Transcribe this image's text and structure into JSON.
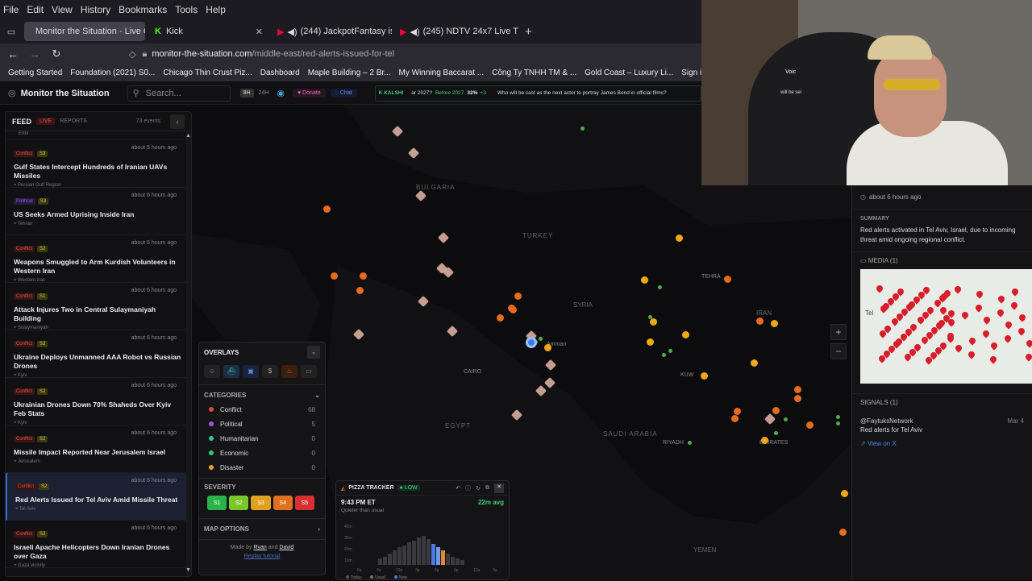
{
  "menubar": [
    "File",
    "Edit",
    "View",
    "History",
    "Bookmarks",
    "Tools",
    "Help"
  ],
  "tabs": [
    {
      "label": "Monitor the Situation - Live Gl",
      "active": true
    },
    {
      "label": "Kick",
      "active": false
    },
    {
      "label": "(244) JackpotFantasy is live!",
      "active": false
    },
    {
      "label": "(245) NDTV 24x7 Live TV: I",
      "active": false
    }
  ],
  "url": {
    "host": "monitor-the-situation.com",
    "path": "/middle-east/red-alerts-issued-for-tel"
  },
  "bookmarks": [
    "Getting Started",
    "Foundation (2021) S0...",
    "Chicago Thin Crust Piz...",
    "Dashboard",
    "Maple Building – 2 Br...",
    "My Winning Baccarat ...",
    "Công Ty TNHH TM & ...",
    "Gold Coast – Luxury Li...",
    "Sign in - Drea"
  ],
  "app": {
    "title": "Monitor the Situation",
    "search_placeholder": "Search...",
    "range_8h": "8H",
    "range_24h": "24H",
    "donate": "Donate",
    "chat": "Chat",
    "kalshi": "KALSHI",
    "ticker_q1": "ar 2027?",
    "ticker_before": "Before 2027",
    "ticker_pct": "32%",
    "ticker_delta": "+3",
    "ticker_q2": "Who will be cast as the next actor to portray James Bond in official films?"
  },
  "feed": {
    "title": "FEED",
    "live": "LIVE",
    "reports": "REPORTS",
    "count": "73 events",
    "top_loc": "Erbil",
    "items": [
      {
        "cat": "Conflict",
        "sev": "S3",
        "time": "about 5 hours ago",
        "title": "Gulf States Intercept Hundreds of Iranian UAVs Missiles",
        "loc": "Persian Gulf Region"
      },
      {
        "cat": "Political",
        "sev": "S3",
        "time": "about 6 hours ago",
        "title": "US Seeks Armed Uprising Inside Iran",
        "loc": "Tehran"
      },
      {
        "cat": "Conflict",
        "sev": "S2",
        "time": "about 6 hours ago",
        "title": "Weapons Smuggled to Arm Kurdish Volunteers in Western Iran",
        "loc": "Western Iran"
      },
      {
        "cat": "Conflict",
        "sev": "S1",
        "time": "about 6 hours ago",
        "title": "Attack Injures Two in Central Sulaymaniyah Building",
        "loc": "Sulaymaniyah"
      },
      {
        "cat": "Conflict",
        "sev": "S2",
        "time": "about 6 hours ago",
        "title": "Ukraine Deploys Unmanned AAA Robot vs Russian Drones",
        "loc": "Kyiv"
      },
      {
        "cat": "Conflict",
        "sev": "S2",
        "time": "about 6 hours ago",
        "title": "Ukrainian Drones Down 70% Shaheds Over Kyiv Feb Stats",
        "loc": "Kyiv"
      },
      {
        "cat": "Conflict",
        "sev": "S2",
        "time": "about 6 hours ago",
        "title": "Missile Impact Reported Near Jerusalem Israel",
        "loc": "Jerusalem"
      },
      {
        "cat": "Conflict",
        "sev": "S2",
        "time": "about 6 hours ago",
        "title": "Red Alerts Issued for Tel Aviv Amid Missile Threat",
        "loc": "Tel Aviv"
      },
      {
        "cat": "Conflict",
        "sev": "S2",
        "time": "about 6 hours ago",
        "title": "Israeli Apache Helicopters Down Iranian Drones over Gaza",
        "loc": "Gaza vicinity"
      }
    ]
  },
  "map_labels": [
    "BULGARIA",
    "TURKEY",
    "SYRIA",
    "TEHRA",
    "IRAN",
    "CAIRO",
    "EGYPT",
    "SAUDI ARABIA",
    "RIYADH",
    "KUW",
    "EMIRATES",
    "Amman",
    "YEMEN"
  ],
  "overlays": {
    "title": "OVERLAYS",
    "categories_title": "CATEGORIES",
    "categories": [
      {
        "name": "Conflict",
        "count": "68",
        "color": "#e0483a"
      },
      {
        "name": "Political",
        "count": "5",
        "color": "#9b59e0"
      },
      {
        "name": "Humanitarian",
        "count": "0",
        "color": "#2ec4a3"
      },
      {
        "name": "Economic",
        "count": "0",
        "color": "#2ecc71"
      },
      {
        "name": "Disaster",
        "count": "0",
        "color": "#f0a020"
      }
    ],
    "severity_title": "SEVERITY",
    "severity": [
      {
        "label": "S1",
        "color": "#2ab34a"
      },
      {
        "label": "S2",
        "color": "#7bc62c"
      },
      {
        "label": "S3",
        "color": "#e0a020"
      },
      {
        "label": "S4",
        "color": "#e07020"
      },
      {
        "label": "S5",
        "color": "#d83030"
      }
    ],
    "map_options": "MAP OPTIONS",
    "made_by": "Made by",
    "author1": "Ryan",
    "and": "and",
    "author2": "David",
    "replay": "Replay tutorial"
  },
  "pizza": {
    "title": "PIZZA TRACKER",
    "status": "LOW",
    "time": "9:43 PM ET",
    "avg": "22m avg",
    "note": "Quieter than usual",
    "legend": [
      "Today",
      "Usual",
      "Now"
    ],
    "xticks": [
      "6a",
      "9a",
      "12p",
      "3p",
      "6p",
      "9p",
      "12a",
      "3a"
    ],
    "yticks": [
      "40m",
      "30m",
      "20m",
      "10m"
    ]
  },
  "detail": {
    "time": "about 6 hours ago",
    "summary_title": "SUMMARY",
    "summary": "Red alerts activated in Tel Aviv, Israel, due to incoming threat amid ongoing regional conflict.",
    "media_title": "MEDIA (1)",
    "media_label": "Tel",
    "signals_title": "SIGNALS (1)",
    "signal_user": "@FaytuksNetwork",
    "signal_date": "Mar 4",
    "signal_text": "Red alerts for Tel Aviv",
    "view_on_x": "View on X"
  },
  "webcam": {
    "sign1": "Voic",
    "sign2": "will be sei"
  }
}
